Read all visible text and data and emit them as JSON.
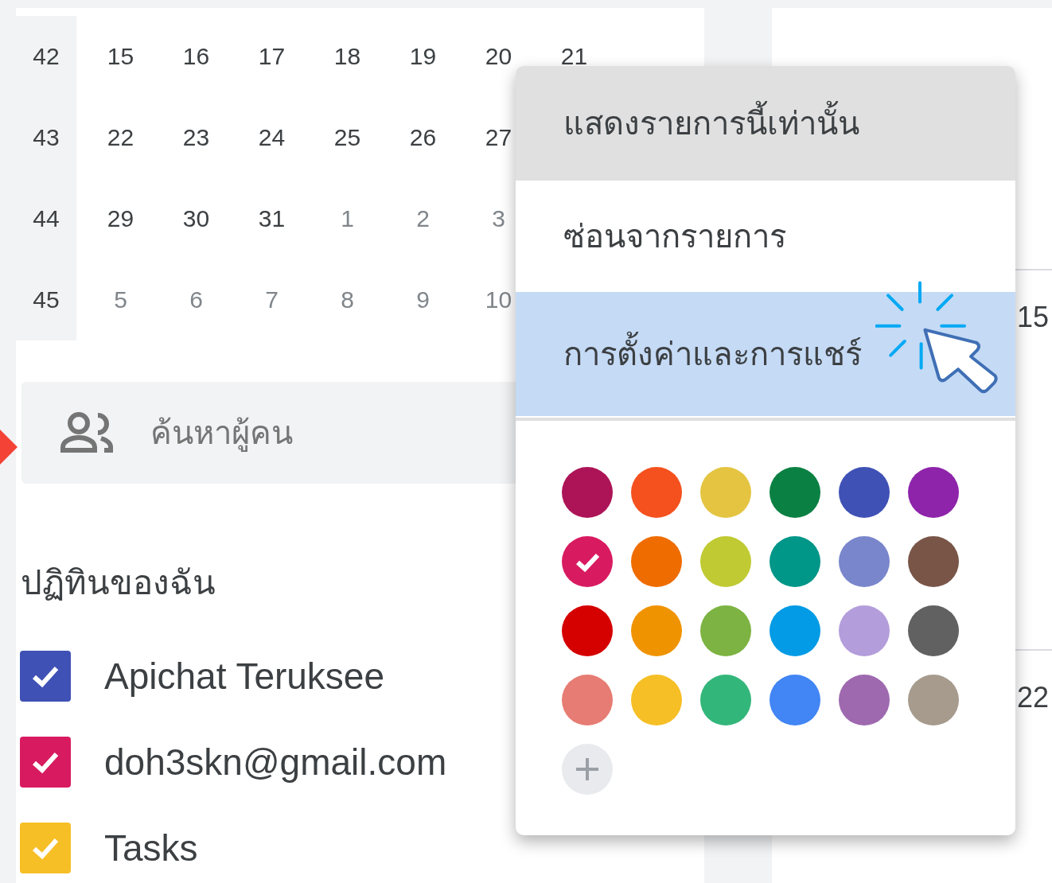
{
  "mini_calendar": {
    "weeks": [
      {
        "week": "42",
        "days": [
          {
            "label": "15",
            "other_month": false
          },
          {
            "label": "16",
            "other_month": false
          },
          {
            "label": "17",
            "other_month": false
          },
          {
            "label": "18",
            "other_month": false
          },
          {
            "label": "19",
            "other_month": false
          },
          {
            "label": "20",
            "other_month": false
          },
          {
            "label": "21",
            "other_month": false
          }
        ]
      },
      {
        "week": "43",
        "days": [
          {
            "label": "22",
            "other_month": false
          },
          {
            "label": "23",
            "other_month": false
          },
          {
            "label": "24",
            "other_month": false
          },
          {
            "label": "25",
            "other_month": false
          },
          {
            "label": "26",
            "other_month": false
          },
          {
            "label": "27",
            "other_month": false
          }
        ]
      },
      {
        "week": "44",
        "days": [
          {
            "label": "29",
            "other_month": false
          },
          {
            "label": "30",
            "other_month": false
          },
          {
            "label": "31",
            "other_month": false
          },
          {
            "label": "1",
            "other_month": true
          },
          {
            "label": "2",
            "other_month": true
          },
          {
            "label": "3",
            "other_month": true
          }
        ]
      },
      {
        "week": "45",
        "days": [
          {
            "label": "5",
            "other_month": true
          },
          {
            "label": "6",
            "other_month": true
          },
          {
            "label": "7",
            "other_month": true
          },
          {
            "label": "8",
            "other_month": true
          },
          {
            "label": "9",
            "other_month": true
          },
          {
            "label": "10",
            "other_month": true
          }
        ]
      }
    ]
  },
  "people_search": {
    "placeholder": "ค้นหาผู้คน"
  },
  "my_calendars": {
    "title": "ปฏิทินของฉัน",
    "items": [
      {
        "name": "Apichat Teruksee",
        "checked": true,
        "color": "#3f51b5"
      },
      {
        "name": "doh3skn@gmail.com",
        "checked": true,
        "color": "#d81b60"
      },
      {
        "name": "Tasks",
        "checked": true,
        "color": "#f6bf26"
      }
    ]
  },
  "main": {
    "day_numbers": [
      "15",
      "22"
    ]
  },
  "context_menu": {
    "items": [
      {
        "label": "แสดงรายการนี้เท่านั้น",
        "highlighted": true,
        "annotated": false
      },
      {
        "label": "ซ่อนจากรายการ",
        "highlighted": false,
        "annotated": false
      },
      {
        "label": "การตั้งค่าและการแชร์",
        "highlighted": false,
        "annotated": true
      }
    ],
    "colors": [
      {
        "color": "#ad1457",
        "selected": false
      },
      {
        "color": "#f4511e",
        "selected": false
      },
      {
        "color": "#e4c441",
        "selected": false
      },
      {
        "color": "#0b8043",
        "selected": false
      },
      {
        "color": "#3f51b5",
        "selected": false
      },
      {
        "color": "#8e24aa",
        "selected": false
      },
      {
        "color": "#d81b60",
        "selected": true
      },
      {
        "color": "#ef6c00",
        "selected": false
      },
      {
        "color": "#c0ca33",
        "selected": false
      },
      {
        "color": "#009688",
        "selected": false
      },
      {
        "color": "#7986cb",
        "selected": false
      },
      {
        "color": "#795548",
        "selected": false
      },
      {
        "color": "#d50000",
        "selected": false
      },
      {
        "color": "#f09300",
        "selected": false
      },
      {
        "color": "#7cb342",
        "selected": false
      },
      {
        "color": "#039be5",
        "selected": false
      },
      {
        "color": "#b39ddb",
        "selected": false
      },
      {
        "color": "#616161",
        "selected": false
      },
      {
        "color": "#e67c73",
        "selected": false
      },
      {
        "color": "#f6bf26",
        "selected": false
      },
      {
        "color": "#33b679",
        "selected": false
      },
      {
        "color": "#4285f4",
        "selected": false
      },
      {
        "color": "#9e69af",
        "selected": false
      },
      {
        "color": "#a79b8e",
        "selected": false
      }
    ]
  }
}
